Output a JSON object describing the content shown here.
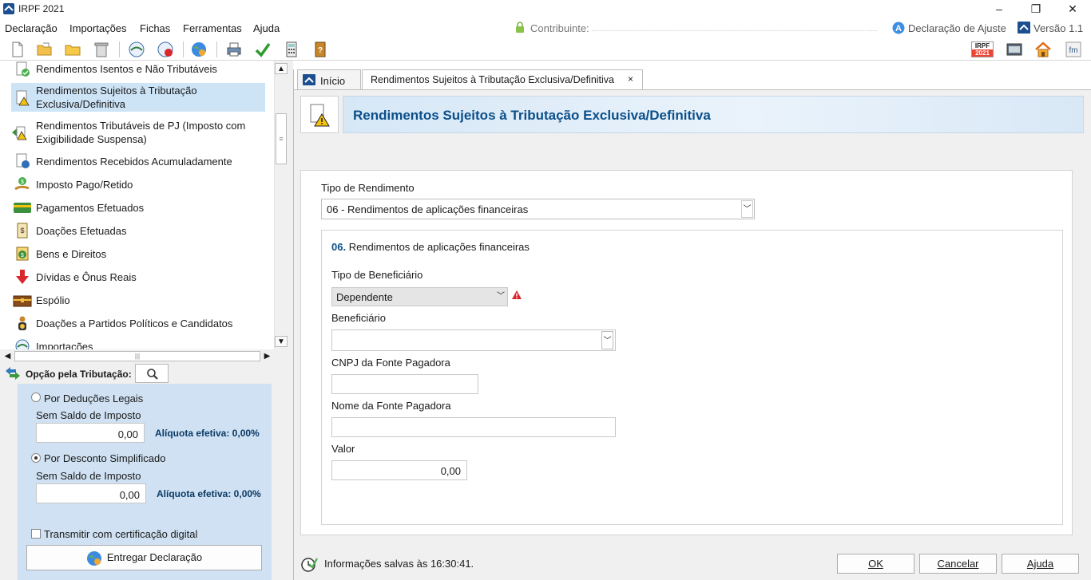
{
  "window": {
    "title": "IRPF 2021",
    "controls": [
      "–",
      "❐",
      "✕"
    ]
  },
  "menu": {
    "items": [
      "Declaração",
      "Importações",
      "Fichas",
      "Ferramentas",
      "Ajuda"
    ],
    "contribuinte_label": "Contribuinte:",
    "declaracao_tipo": "Declaração de Ajuste",
    "versao": "Versão 1.1"
  },
  "toolbar": {
    "irpf_badge_top": "IRPF",
    "irpf_badge_bottom": "2021"
  },
  "nav": {
    "items": [
      {
        "label": "Rendimentos Isentos e Não Tributáveis",
        "icon": "check-document-icon"
      },
      {
        "label": "Rendimentos Sujeitos à Tributação Exclusiva/Definitiva",
        "icon": "warning-document-icon"
      },
      {
        "label": "Rendimentos Tributáveis de PJ (Imposto com Exigibilidade Suspensa)",
        "icon": "suspended-income-icon"
      },
      {
        "label": "Rendimentos Recebidos Acumuladamente",
        "icon": "accumulated-income-icon"
      },
      {
        "label": "Imposto Pago/Retido",
        "icon": "hand-coin-icon"
      },
      {
        "label": "Pagamentos Efetuados",
        "icon": "credit-card-icon"
      },
      {
        "label": "Doações Efetuadas",
        "icon": "donation-document-icon"
      },
      {
        "label": "Bens e Direitos",
        "icon": "money-bag-icon"
      },
      {
        "label": "Dívidas e Ônus Reais",
        "icon": "red-arrow-down-icon"
      },
      {
        "label": "Espólio",
        "icon": "chest-icon"
      },
      {
        "label": "Doações a Partidos Políticos e Candidatos",
        "icon": "political-donation-icon"
      },
      {
        "label": "Importações",
        "icon": "import-icon"
      }
    ]
  },
  "opcao": {
    "title": "Opção pela Tributação:",
    "deducoes_label": "Por Deduções Legais",
    "deducoes_saldo": "Sem Saldo de Imposto",
    "deducoes_valor": "0,00",
    "deducoes_aliquota": "Alíquota efetiva: 0,00%",
    "simplificado_label": "Por Desconto Simplificado",
    "simplificado_saldo": "Sem Saldo de Imposto",
    "simplificado_valor": "0,00",
    "simplificado_aliquota": "Alíquota efetiva: 0,00%",
    "certificacao_label": "Transmitir com certificação digital",
    "entregar_label": "Entregar Declaração"
  },
  "tabs": {
    "inicio": "Início",
    "active": "Rendimentos Sujeitos à Tributação Exclusiva/Definitiva",
    "close": "×"
  },
  "page": {
    "title": "Rendimentos Sujeitos à Tributação Exclusiva/Definitiva"
  },
  "form": {
    "tipo_rendimento_label": "Tipo de Rendimento",
    "tipo_rendimento_value": "06 - Rendimentos de aplicações financeiras",
    "section_code": "06.",
    "section_title": "Rendimentos de aplicações financeiras",
    "tipo_beneficiario_label": "Tipo de Beneficiário",
    "tipo_beneficiario_value": "Dependente",
    "beneficiario_label": "Beneficiário",
    "beneficiario_value": "",
    "cnpj_label": "CNPJ da Fonte Pagadora",
    "cnpj_value": "",
    "nome_label": "Nome da Fonte Pagadora",
    "nome_value": "",
    "valor_label": "Valor",
    "valor_value": "0,00"
  },
  "footer": {
    "status": "Informações salvas às 16:30:41.",
    "ok": "OK",
    "cancelar": "Cancelar",
    "ajuda": "Ajuda"
  },
  "colors": {
    "accent_blue": "#0b4f8a",
    "selected_row": "#cde4f7",
    "option_panel": "#cfe1f2",
    "warning_red": "#d9272e"
  }
}
